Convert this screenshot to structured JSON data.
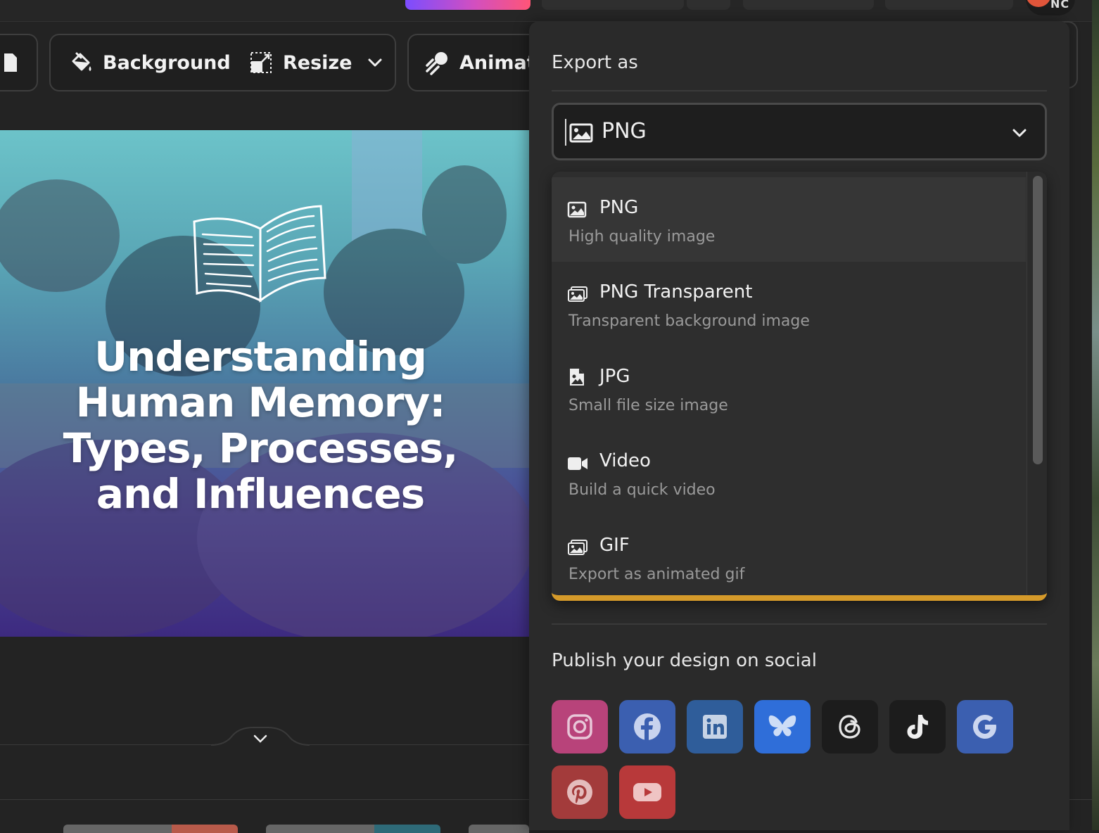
{
  "toolbar": {
    "background_label": "Background",
    "resize_label": "Resize",
    "animate_label": "Animate"
  },
  "topbar": {
    "avatar_initials": "NC"
  },
  "design": {
    "title": "Understanding Human Memory: Types, Processes, and Influences"
  },
  "export_panel": {
    "title": "Export as",
    "selected_format": "PNG",
    "options": [
      {
        "label": "PNG",
        "description": "High quality image",
        "icon": "image-icon"
      },
      {
        "label": "PNG Transparent",
        "description": "Transparent background image",
        "icon": "images-icon"
      },
      {
        "label": "JPG",
        "description": "Small file size image",
        "icon": "file-image-icon"
      },
      {
        "label": "Video",
        "description": "Build a quick video",
        "icon": "video-camera-icon"
      },
      {
        "label": "GIF",
        "description": "Export as animated gif",
        "icon": "images-icon"
      }
    ],
    "social_title": "Publish your design on social",
    "social": [
      {
        "name": "instagram-icon",
        "color": "#b8437a"
      },
      {
        "name": "facebook-icon",
        "color": "#3b5fb0"
      },
      {
        "name": "linkedin-icon",
        "color": "#2f5d9a"
      },
      {
        "name": "bluesky-icon",
        "color": "#2f6ed9"
      },
      {
        "name": "threads-icon",
        "color": "#1c1c1c"
      },
      {
        "name": "tiktok-icon",
        "color": "#1c1c1c"
      },
      {
        "name": "google-icon",
        "color": "#3b5fb0"
      },
      {
        "name": "pinterest-icon",
        "color": "#a33b3b"
      },
      {
        "name": "youtube-icon",
        "color": "#b8393a"
      }
    ],
    "accent_color": "#d59a2a"
  }
}
